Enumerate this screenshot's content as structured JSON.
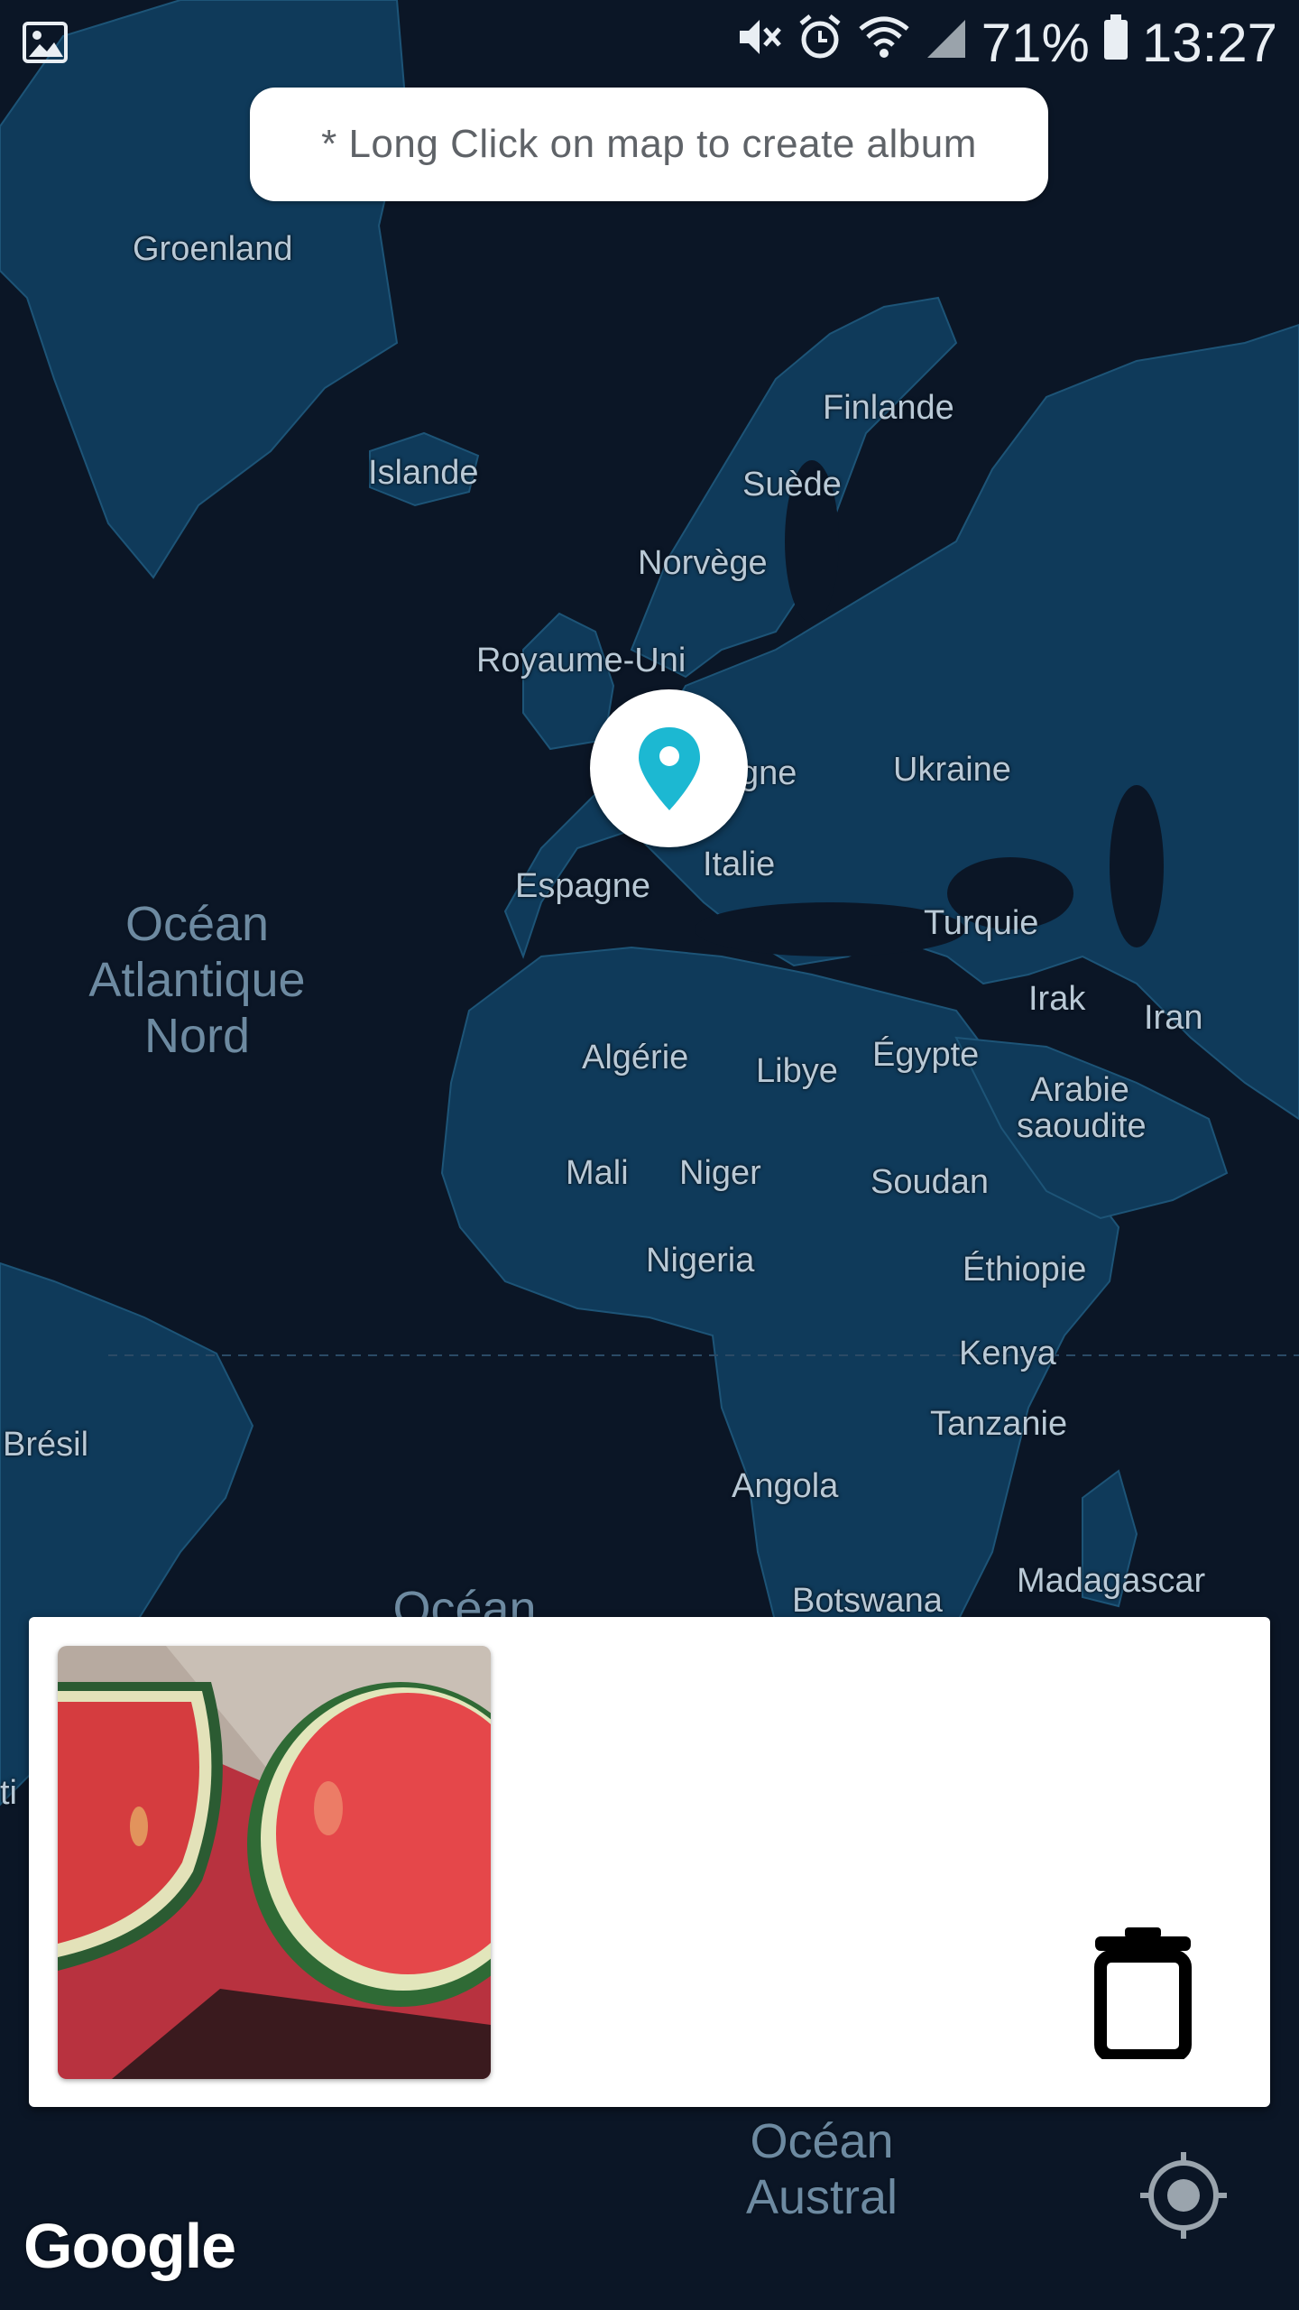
{
  "status_bar": {
    "battery_text": "71%",
    "clock": "13:27",
    "icons": [
      "gallery-icon",
      "mute-icon",
      "alarm-icon",
      "wifi-icon",
      "signal-icon",
      "battery-icon"
    ]
  },
  "hint": {
    "text": "* Long Click on map to create album"
  },
  "map": {
    "countries": [
      "Groenland",
      "Islande",
      "Finlande",
      "Suède",
      "Norvège",
      "Royaume-Uni",
      "gne",
      "Ukraine",
      "Italie",
      "Espagne",
      "Turquie",
      "Irak",
      "Iran",
      "Algérie",
      "Libye",
      "Égypte",
      "Arabie saoudite",
      "Mali",
      "Niger",
      "Soudan",
      "Nigeria",
      "Éthiopie",
      "Kenya",
      "Brésil",
      "Tanzanie",
      "Angola",
      "Botswana",
      "Madagascar",
      "ti"
    ],
    "oceans": [
      "Océan\nAtlantique\nNord",
      "Océan",
      "Océan\nAustral"
    ],
    "colors": {
      "land": "#0f3a5a",
      "water": "#0b1626",
      "marker_accent": "#1cb8d2"
    }
  },
  "panel": {
    "photo_alt": "watermelon halves photo",
    "delete_icon": "trash-icon"
  },
  "footer": {
    "google_logo": "Google",
    "locate_icon": "my-location-icon"
  }
}
